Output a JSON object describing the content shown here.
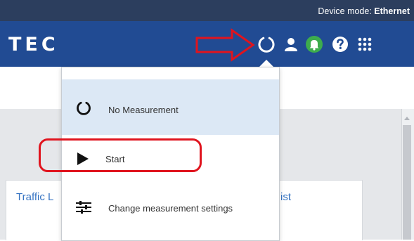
{
  "topbar": {
    "device_mode_label": "Device mode: ",
    "device_mode_value": "Ethernet"
  },
  "header": {
    "logo_text": "TEC",
    "icons": [
      "measurement-status-icon",
      "user-icon",
      "notifications-bell-icon",
      "help-icon",
      "apps-grid-icon"
    ]
  },
  "dropdown": {
    "status_label": "No Measurement",
    "start_label": "Start",
    "settings_label": "Change measurement settings"
  },
  "content": {
    "card_left_text": "Traffic L",
    "card_right_text": "ist"
  },
  "colors": {
    "topbar": "#2c3e5e",
    "navbar": "#214b93",
    "bell_badge": "#3dac4d",
    "selected_item": "#dce8f5",
    "annotation": "#e0141e",
    "link_text": "#3573c2"
  }
}
